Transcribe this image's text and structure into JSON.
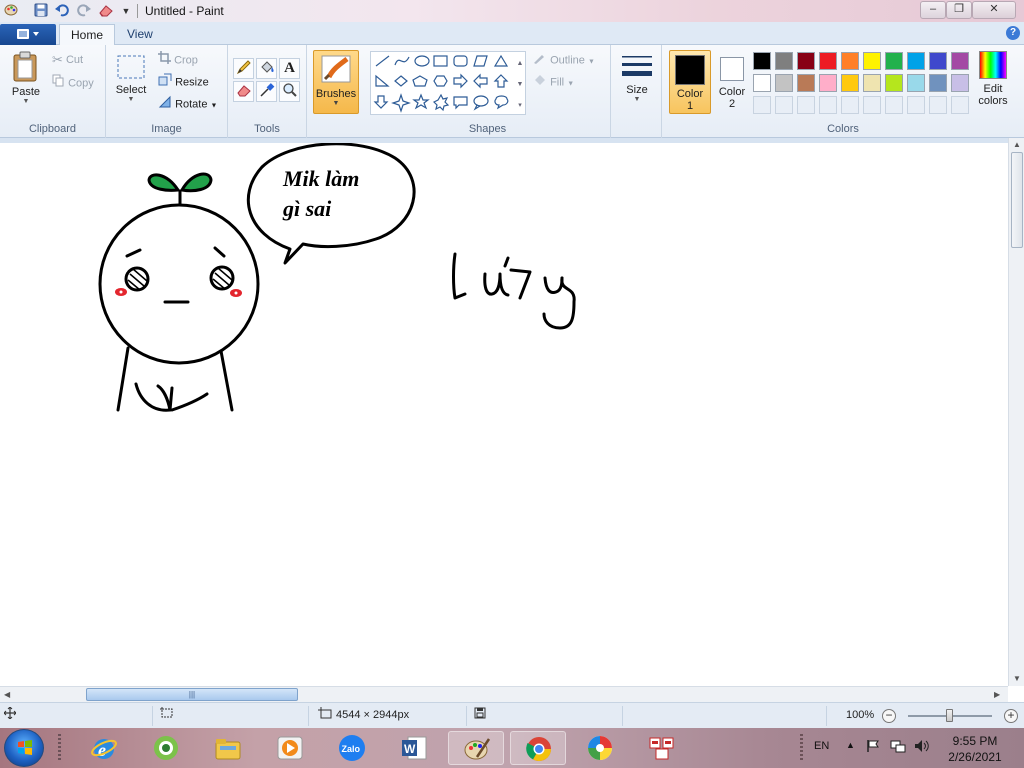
{
  "window": {
    "title": "Untitled - Paint",
    "minimize": "–",
    "restore": "❐",
    "close": "✕"
  },
  "quick_access": [
    "paint-app-icon",
    "save-icon",
    "undo-icon",
    "redo-icon",
    "eraser-icon",
    "customize-dropdown-icon"
  ],
  "tabs": [
    {
      "label": "Home",
      "active": true
    },
    {
      "label": "View",
      "active": false
    }
  ],
  "help": "?",
  "ribbon": {
    "clipboard": {
      "label": "Clipboard",
      "paste": "Paste",
      "cut": "Cut",
      "copy": "Copy"
    },
    "image": {
      "label": "Image",
      "select": "Select",
      "crop": "Crop",
      "resize": "Resize",
      "rotate": "Rotate"
    },
    "tools": {
      "label": "Tools",
      "items": [
        "pencil-icon",
        "fill-icon",
        "text-icon",
        "eraser-icon",
        "color-picker-icon",
        "magnifier-icon"
      ]
    },
    "brushes": {
      "label": "Brushes"
    },
    "shapes": {
      "label": "Shapes",
      "outline": "Outline",
      "fill": "Fill"
    },
    "size": {
      "label": "Size"
    },
    "colors": {
      "label": "Colors",
      "color1": "Color\n1",
      "color1_line1": "Color",
      "color1_line2": "1",
      "color2_line1": "Color",
      "color2_line2": "2",
      "edit_line1": "Edit",
      "edit_line2": "colors",
      "color1_value": "#000000",
      "color2_value": "#ffffff",
      "palette_row1": [
        "#000000",
        "#7f7f7f",
        "#880015",
        "#ed1c24",
        "#ff7f27",
        "#fff200",
        "#22b14c",
        "#00a2e8",
        "#3f48cc",
        "#a349a4"
      ],
      "palette_row2": [
        "#ffffff",
        "#c3c3c3",
        "#b97a57",
        "#ffaec9",
        "#ffc90e",
        "#efe4b0",
        "#b5e61d",
        "#99d9ea",
        "#7092be",
        "#c8bfe7"
      ]
    }
  },
  "canvas": {
    "speech_line1": "Mik làm",
    "speech_line2": "gì sai",
    "handwriting": "lu'ly"
  },
  "status": {
    "dimensions": "4544 × 2944px",
    "zoom": "100%",
    "zoom_fraction": 0.5
  },
  "taskbar": {
    "apps": [
      "internet-explorer-icon",
      "coccoc-browser-icon",
      "file-explorer-icon",
      "media-player-icon",
      "zalo-icon",
      "word-icon",
      "paint-icon",
      "chrome-icon",
      "colorful-app-icon",
      "app-icon"
    ],
    "zalo_label": "Zalo",
    "lang": "EN",
    "time": "9:55 PM",
    "date": "2/26/2021"
  }
}
